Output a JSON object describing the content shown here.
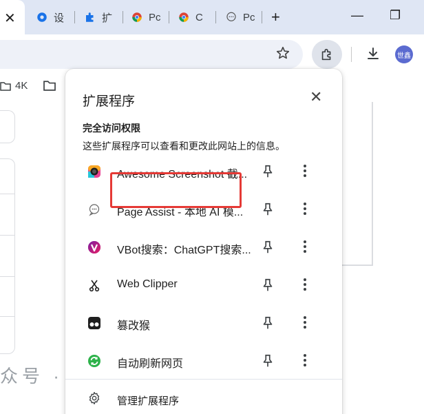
{
  "tabs": {
    "active_close": "✕",
    "items": [
      {
        "label": "设"
      },
      {
        "label": "扩"
      },
      {
        "label": "Pc"
      },
      {
        "label": "C"
      },
      {
        "label": "Pc"
      }
    ],
    "new_tab": "+"
  },
  "window": {
    "minimize": "—",
    "restore": "❐"
  },
  "toolbar": {
    "avatar_text": "世鑫"
  },
  "bookmarks": [
    {
      "label": "4K"
    },
    {
      "label": ""
    }
  ],
  "background": {
    "partial_text": "众号 · 王"
  },
  "popup": {
    "title": "扩展程序",
    "close": "✕",
    "section_title": "完全访问权限",
    "section_desc": "这些扩展程序可以查看和更改此网站上的信息。",
    "extensions": [
      {
        "name": "Awesome Screenshot 截...",
        "icon": "awesome-screenshot-icon"
      },
      {
        "name": "Page Assist - 本地 AI 模...",
        "icon": "page-assist-icon"
      },
      {
        "name": "VBot搜索：ChatGPT搜索...",
        "icon": "vbot-icon"
      },
      {
        "name": "Web Clipper",
        "icon": "scissors-icon"
      },
      {
        "name": "篡改猴",
        "icon": "tampermonkey-icon"
      },
      {
        "name": "自动刷新网页",
        "icon": "auto-refresh-icon"
      }
    ],
    "manage_label": "管理扩展程序"
  },
  "colors": {
    "highlight": "#e53935",
    "tabstrip": "#dfe6f4",
    "avatar": "#5b6bd0"
  }
}
